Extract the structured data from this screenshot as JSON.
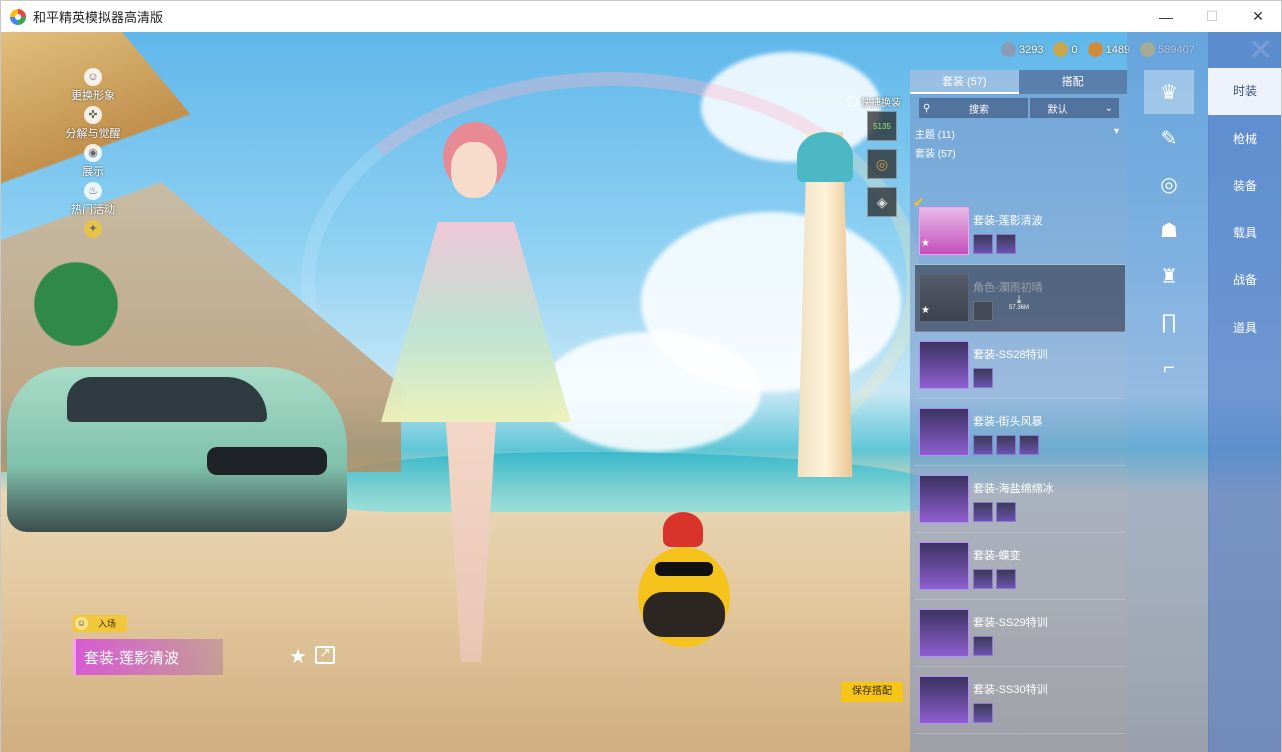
{
  "window": {
    "title": "和平精英模拟器高清版",
    "controls": [
      "—",
      "☐",
      "✕"
    ]
  },
  "left_menu": [
    {
      "label": "更换形象",
      "icon": "avatar-icon"
    },
    {
      "label": "分解与觉醒",
      "icon": "split-icon"
    },
    {
      "label": "展示",
      "icon": "eye-icon"
    },
    {
      "label": "热门活动",
      "icon": "fire-icon"
    },
    {
      "label": "",
      "icon": "badge-icon"
    }
  ],
  "outfit_display": {
    "entrance_label": "入场",
    "name": "套装-莲影清波"
  },
  "quick_swap": {
    "label": "快捷换装",
    "slot1_text": "5135"
  },
  "currency": [
    {
      "icon": "uc-icon",
      "value": "3293",
      "color": "#8a9bb5"
    },
    {
      "icon": "ag-icon",
      "value": "0",
      "color": "#c8a64a"
    },
    {
      "icon": "coupon-icon",
      "value": "1489",
      "color": "#d08b3a"
    },
    {
      "icon": "bp-coin-icon",
      "value": "589407",
      "color": "#e7c34a"
    }
  ],
  "panel": {
    "tabs": [
      "套装 (57)",
      "搭配"
    ],
    "search_placeholder": "搜索",
    "sort_label": "默认",
    "theme_label": "主题 (11)",
    "count_label": "套装 (57)",
    "items": [
      {
        "name": "套装-莲影清波",
        "parts": 2,
        "style": "pink",
        "checked": true
      },
      {
        "name": "角色-瀾雨初晴",
        "parts": 1,
        "style": "dim",
        "download_size": "57.36M"
      },
      {
        "name": "套装-SS28特训",
        "parts": 1,
        "style": "purple"
      },
      {
        "name": "套装-街头风暴",
        "parts": 3,
        "style": "purple"
      },
      {
        "name": "套装-海盐绵绵冰",
        "parts": 2,
        "style": "purple"
      },
      {
        "name": "套装-蝶变",
        "parts": 2,
        "style": "purple"
      },
      {
        "name": "套装-SS29特训",
        "parts": 1,
        "style": "purple"
      },
      {
        "name": "套装-SS30特训",
        "parts": 1,
        "style": "purple"
      }
    ],
    "save_label": "保存搭配"
  },
  "side_icons": [
    "outfit-icon",
    "spray-icon",
    "goggles-icon",
    "mask-icon",
    "shirt-icon",
    "pants-icon",
    "shoes-icon"
  ],
  "categories": [
    "时装",
    "枪械",
    "装备",
    "载具",
    "战备",
    "道具"
  ]
}
